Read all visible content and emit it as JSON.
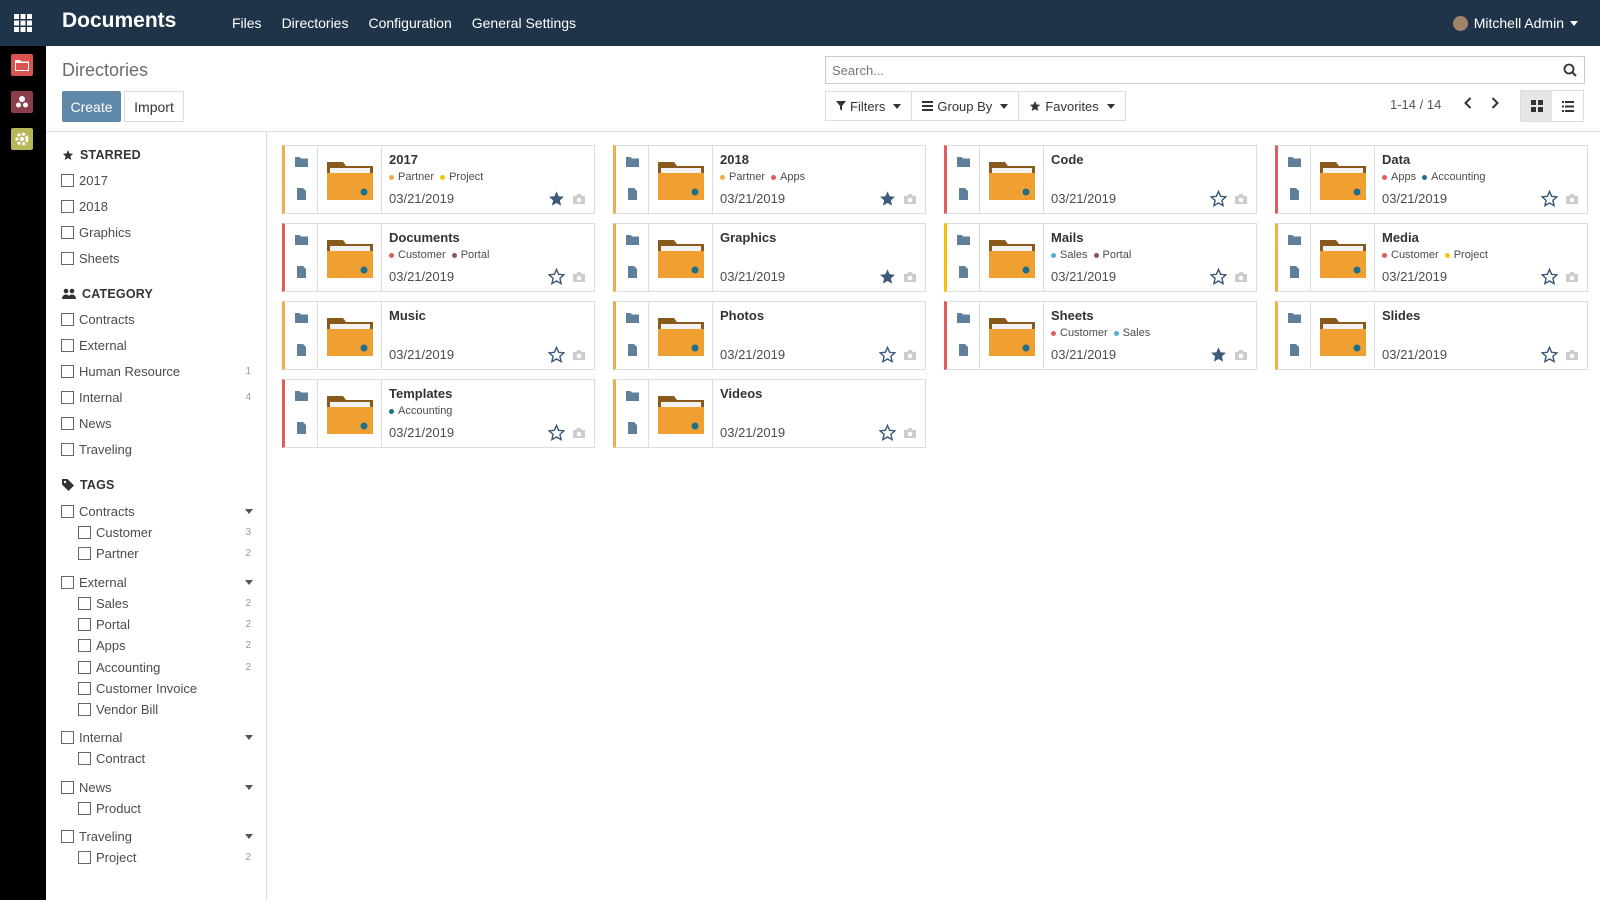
{
  "navbar": {
    "brand": "Documents",
    "menu": [
      "Files",
      "Directories",
      "Configuration",
      "General Settings"
    ],
    "user": "Mitchell Admin"
  },
  "rail_apps": [
    {
      "icon": "folder-icon",
      "color": "#d9534f"
    },
    {
      "icon": "sign-icon",
      "color": "#8c3d4b"
    },
    {
      "icon": "gear-icon",
      "color": "#b6b65a"
    }
  ],
  "control": {
    "breadcrumb": "Directories",
    "create_label": "Create",
    "import_label": "Import",
    "search_placeholder": "Search...",
    "filters_label": "Filters",
    "groupby_label": "Group By",
    "favorites_label": "Favorites",
    "pager": "1-14 / 14",
    "view_mode": "kanban"
  },
  "sidebar": {
    "starred_title": "STARRED",
    "starred": [
      "2017",
      "2018",
      "Graphics",
      "Sheets"
    ],
    "category_title": "CATEGORY",
    "categories": [
      {
        "label": "Contracts",
        "count": ""
      },
      {
        "label": "External",
        "count": ""
      },
      {
        "label": "Human Resource",
        "count": "1"
      },
      {
        "label": "Internal",
        "count": "4"
      },
      {
        "label": "News",
        "count": ""
      },
      {
        "label": "Traveling",
        "count": ""
      }
    ],
    "tags_title": "TAGS",
    "tag_groups": [
      {
        "label": "Contracts",
        "items": [
          {
            "label": "Customer",
            "count": "3"
          },
          {
            "label": "Partner",
            "count": "2"
          }
        ]
      },
      {
        "label": "External",
        "items": [
          {
            "label": "Sales",
            "count": "2"
          },
          {
            "label": "Portal",
            "count": "2"
          },
          {
            "label": "Apps",
            "count": "2"
          },
          {
            "label": "Accounting",
            "count": "2"
          },
          {
            "label": "Customer Invoice",
            "count": ""
          },
          {
            "label": "Vendor Bill",
            "count": ""
          }
        ]
      },
      {
        "label": "Internal",
        "items": [
          {
            "label": "Contract",
            "count": ""
          }
        ]
      },
      {
        "label": "News",
        "items": [
          {
            "label": "Product",
            "count": ""
          }
        ]
      },
      {
        "label": "Traveling",
        "items": [
          {
            "label": "Project",
            "count": "2"
          }
        ]
      }
    ]
  },
  "colors": {
    "orange": "#f0ad4e",
    "yellow": "#f4c20d",
    "red": "#e05c5c",
    "purple": "#8e4f7a",
    "blue": "#5ca9d6",
    "teal": "#1f6e8c",
    "navbar": "#1f3449",
    "accent": "#5f87a8"
  },
  "cards": [
    {
      "name": "2017",
      "date": "03/21/2019",
      "starred": true,
      "border": "#f0ad4e",
      "tags": [
        {
          "label": "Partner",
          "color": "#f0ad4e"
        },
        {
          "label": "Project",
          "color": "#f4c20d"
        }
      ]
    },
    {
      "name": "2018",
      "date": "03/21/2019",
      "starred": true,
      "border": "#f0ad4e",
      "tags": [
        {
          "label": "Partner",
          "color": "#f0ad4e"
        },
        {
          "label": "Apps",
          "color": "#e05c5c"
        }
      ]
    },
    {
      "name": "Code",
      "date": "03/21/2019",
      "starred": false,
      "border": "#e05c5c",
      "tags": []
    },
    {
      "name": "Data",
      "date": "03/21/2019",
      "starred": false,
      "border": "#e05c5c",
      "tags": [
        {
          "label": "Apps",
          "color": "#e05c5c"
        },
        {
          "label": "Accounting",
          "color": "#1f6e8c"
        }
      ]
    },
    {
      "name": "Documents",
      "date": "03/21/2019",
      "starred": false,
      "border": "#e05c5c",
      "tags": [
        {
          "label": "Customer",
          "color": "#e05c5c"
        },
        {
          "label": "Portal",
          "color": "#8e4f7a"
        }
      ]
    },
    {
      "name": "Graphics",
      "date": "03/21/2019",
      "starred": true,
      "border": "#f0ad4e",
      "tags": []
    },
    {
      "name": "Mails",
      "date": "03/21/2019",
      "starred": false,
      "border": "#f4c20d",
      "tags": [
        {
          "label": "Sales",
          "color": "#5ca9d6"
        },
        {
          "label": "Portal",
          "color": "#8e4f7a"
        }
      ]
    },
    {
      "name": "Media",
      "date": "03/21/2019",
      "starred": false,
      "border": "#f0ad4e",
      "tags": [
        {
          "label": "Customer",
          "color": "#e05c5c"
        },
        {
          "label": "Project",
          "color": "#f4c20d"
        }
      ]
    },
    {
      "name": "Music",
      "date": "03/21/2019",
      "starred": false,
      "border": "#f0ad4e",
      "tags": []
    },
    {
      "name": "Photos",
      "date": "03/21/2019",
      "starred": false,
      "border": "#f0ad4e",
      "tags": []
    },
    {
      "name": "Sheets",
      "date": "03/21/2019",
      "starred": true,
      "border": "#e05c5c",
      "tags": [
        {
          "label": "Customer",
          "color": "#e05c5c"
        },
        {
          "label": "Sales",
          "color": "#5ca9d6"
        }
      ]
    },
    {
      "name": "Slides",
      "date": "03/21/2019",
      "starred": false,
      "border": "#f0ad4e",
      "tags": []
    },
    {
      "name": "Templates",
      "date": "03/21/2019",
      "starred": false,
      "border": "#e05c5c",
      "tags": [
        {
          "label": "Accounting",
          "color": "#1f6e8c"
        }
      ]
    },
    {
      "name": "Videos",
      "date": "03/21/2019",
      "starred": false,
      "border": "#f0ad4e",
      "tags": []
    }
  ]
}
